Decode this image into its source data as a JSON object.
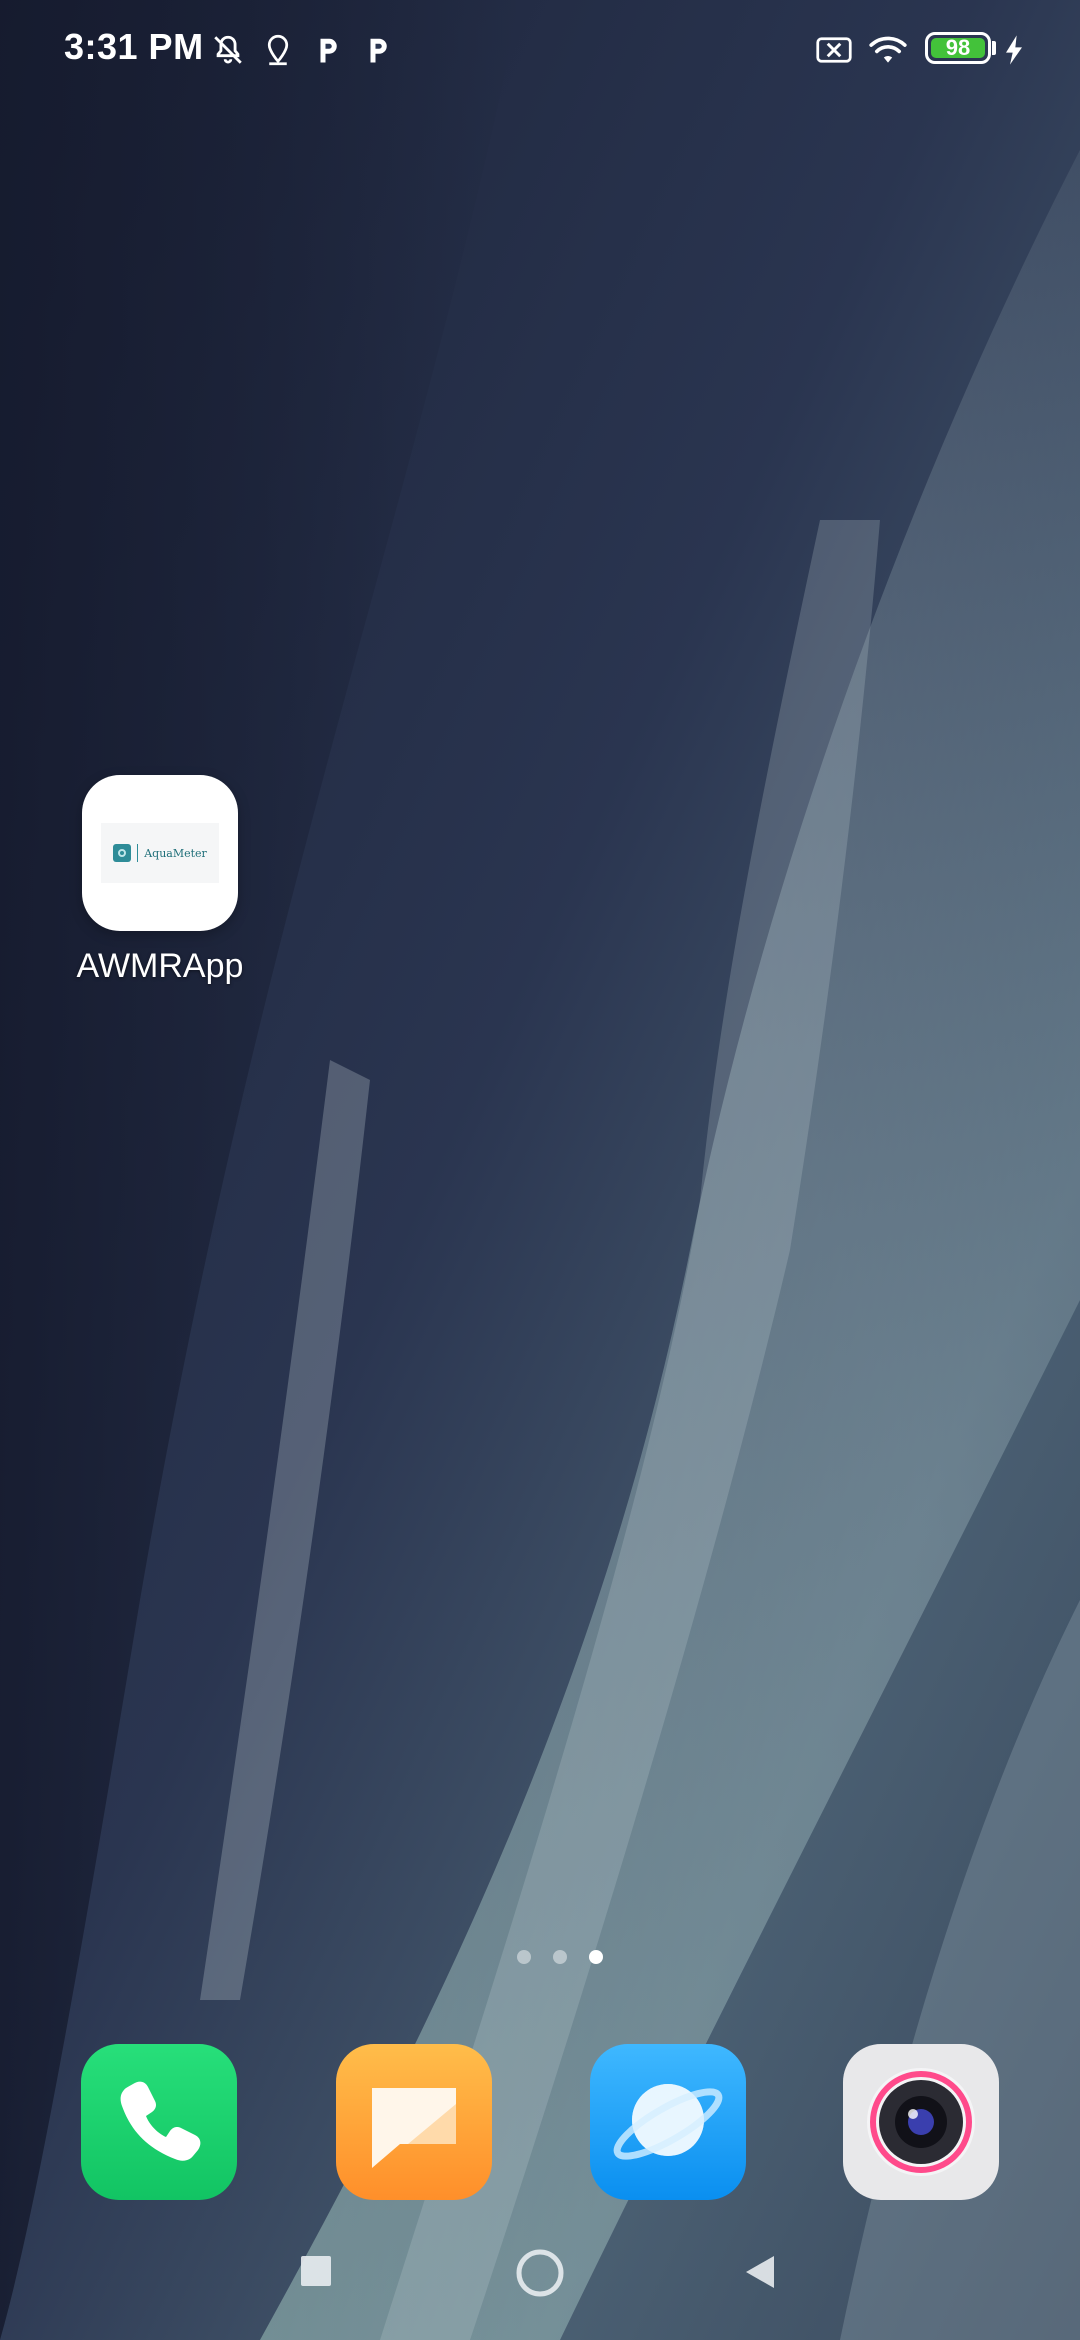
{
  "status_bar": {
    "time": "3:31 PM",
    "left_icons": [
      "muted-bell-icon",
      "location-pin-icon",
      "parking-p-icon",
      "parking-p-icon"
    ],
    "right_icons": [
      "no-sim-icon",
      "wifi-icon",
      "battery-icon",
      "charging-bolt-icon"
    ],
    "battery_level": "98",
    "battery_color": "#43c23a"
  },
  "home": {
    "app": {
      "label": "AWMRApp",
      "logo_text": "AquaMeter",
      "logo_color": "#2e8c98"
    },
    "pages": {
      "count": 3,
      "active_index": 2
    }
  },
  "dock": {
    "apps": [
      {
        "name": "phone",
        "icon": "phone-icon",
        "color": "#1ed36f"
      },
      {
        "name": "messages",
        "icon": "message-icon",
        "color": "#ffa53a"
      },
      {
        "name": "browser",
        "icon": "planet-icon",
        "color": "#1aa6ff"
      },
      {
        "name": "camera",
        "icon": "camera-lens-icon",
        "color": "#e8e8ea"
      }
    ]
  },
  "nav_bar": {
    "buttons": [
      "recents-square-icon",
      "home-circle-icon",
      "back-triangle-icon"
    ]
  }
}
